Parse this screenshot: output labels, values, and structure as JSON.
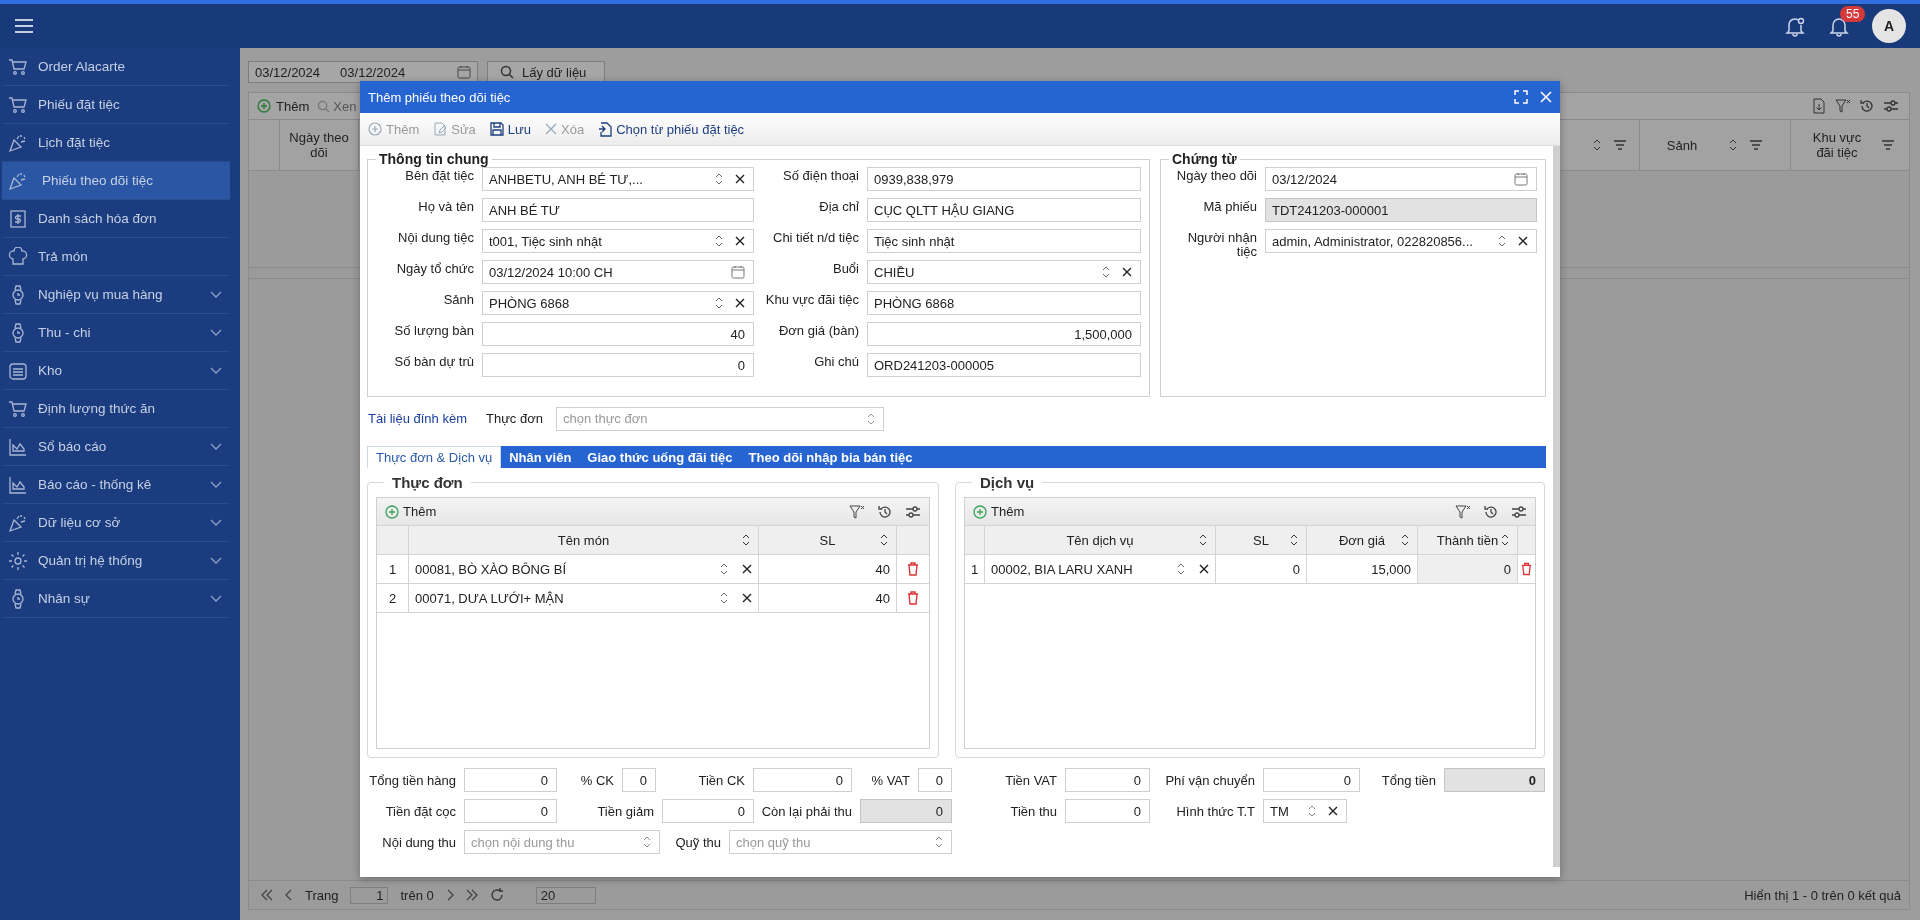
{
  "header": {
    "badge": "55",
    "avatar": "A"
  },
  "sidebar": {
    "items": [
      {
        "label": "Order Alacarte",
        "kind": "link",
        "selected": false
      },
      {
        "label": "Phiếu đặt tiệc",
        "kind": "link",
        "selected": false
      },
      {
        "label": "Lịch đặt tiệc",
        "kind": "link",
        "selected": false
      },
      {
        "label": "Phiếu theo dõi tiệc",
        "kind": "link",
        "selected": true
      },
      {
        "label": "Danh sách hóa đơn",
        "kind": "link",
        "selected": false
      },
      {
        "label": "Trả món",
        "kind": "link",
        "selected": false
      },
      {
        "label": "Nghiệp vụ mua hàng",
        "kind": "group",
        "selected": false
      },
      {
        "label": "Thu - chi",
        "kind": "group",
        "selected": false
      },
      {
        "label": "Kho",
        "kind": "group",
        "selected": false
      },
      {
        "label": "Định lượng thức ăn",
        "kind": "link",
        "selected": false
      },
      {
        "label": "Sổ báo cáo",
        "kind": "group",
        "selected": false
      },
      {
        "label": "Báo cáo - thống kê",
        "kind": "group",
        "selected": false
      },
      {
        "label": "Dữ liệu cơ sở",
        "kind": "group",
        "selected": false
      },
      {
        "label": "Quản trị hệ thống",
        "kind": "group",
        "selected": false
      },
      {
        "label": "Nhân sự",
        "kind": "group",
        "selected": false
      }
    ]
  },
  "page": {
    "date_from": "03/12/2024",
    "date_to": "03/12/2024",
    "fetch_button": "Lấy dữ liệu",
    "toolbar": [
      "Thêm",
      "Xen"
    ],
    "columns": [
      "Ngày theo dõi",
      "Sảnh",
      "Khu vực đãi tiệc"
    ],
    "pager": {
      "label": "Trang",
      "page": "1",
      "of": "trên 0",
      "size": "20",
      "summary": "Hiển thị 1 - 0 trên 0 kết quả"
    }
  },
  "modal": {
    "title": "Thêm phiếu theo dõi tiệc",
    "toolbar": [
      {
        "label": "Thêm",
        "disabled": true
      },
      {
        "label": "Sửa",
        "disabled": true
      },
      {
        "label": "Lưu",
        "disabled": false
      },
      {
        "label": "Xóa",
        "disabled": true
      },
      {
        "label": "Chọn từ phiếu đặt tiệc",
        "disabled": false
      }
    ],
    "general": {
      "title": "Thông tin chung",
      "left": [
        {
          "label": "Bên đặt tiệc",
          "value": "ANHBETU, ANH BÉ TƯ,...",
          "kind": "select",
          "readonly": false
        },
        {
          "label": "Họ và tên",
          "value": "ANH BÉ TƯ",
          "kind": "text",
          "readonly": false
        },
        {
          "label": "Nội dung tiệc",
          "value": "t001, Tiệc sinh nhật",
          "kind": "select",
          "readonly": false
        },
        {
          "label": "Ngày tổ chức",
          "value": "03/12/2024 10:00 CH",
          "kind": "date",
          "readonly": false
        },
        {
          "label": "Sảnh",
          "value": "PHÒNG 6868",
          "kind": "select",
          "readonly": false
        },
        {
          "label": "Số lượng bàn",
          "value": "40",
          "kind": "number",
          "readonly": false
        },
        {
          "label": "Số bàn dự trù",
          "value": "0",
          "kind": "number",
          "readonly": false
        }
      ],
      "right": [
        {
          "label": "Số điện thoại",
          "value": "0939,838,979",
          "kind": "text",
          "readonly": false
        },
        {
          "label": "Địa chỉ",
          "value": "CỤC QLTT HẬU GIANG",
          "kind": "text",
          "readonly": false
        },
        {
          "label": "Chi tiết n/d tiệc",
          "value": "Tiệc sinh nhật",
          "kind": "text",
          "readonly": false
        },
        {
          "label": "Buổi",
          "value": "CHIỀU",
          "kind": "select",
          "readonly": false
        },
        {
          "label": "Khu vực đãi tiệc",
          "value": "PHÒNG 6868",
          "kind": "text",
          "readonly": false
        },
        {
          "label": "Đơn giá (bàn)",
          "value": "1,500,000",
          "kind": "number",
          "readonly": false
        },
        {
          "label": "Ghi chú",
          "value": "ORD241203-000005",
          "kind": "text",
          "readonly": false
        }
      ]
    },
    "voucher": {
      "title": "Chứng từ",
      "fields": [
        {
          "label": "Ngày theo dõi",
          "value": "03/12/2024",
          "kind": "date",
          "readonly": false
        },
        {
          "label": "Mã phiếu",
          "value": "TDT241203-000001",
          "kind": "text",
          "readonly": true
        },
        {
          "label": "Người nhận tiệc",
          "value": "admin, Administrator, 022820856...",
          "kind": "select",
          "readonly": false
        }
      ]
    },
    "attachments": "Tài liệu đính kèm",
    "menu_select": {
      "label": "Thực đơn",
      "placeholder": "chọn thực đơn",
      "kind": "dropdown",
      "readonly": false
    },
    "tabs": [
      {
        "label": "Thực đơn & Dịch vụ",
        "selected": true
      },
      {
        "label": "Nhân viên",
        "selected": false
      },
      {
        "label": "Giao thức uống đãi tiệc",
        "selected": false
      },
      {
        "label": "Theo dõi nhập bia bán tiệc",
        "selected": false
      }
    ],
    "menu": {
      "title": "Thực đơn",
      "add": "Thêm",
      "columns": [
        "Tên món",
        "SL"
      ],
      "rows": [
        {
          "no": "1",
          "name": "00081, BÒ XÀO BÔNG BÍ",
          "qty": "40"
        },
        {
          "no": "2",
          "name": "00071, DƯA LƯỚI+ MẬN",
          "qty": "40"
        }
      ]
    },
    "services": {
      "title": "Dịch vụ",
      "add": "Thêm",
      "columns": [
        "Tên dịch vụ",
        "SL",
        "Đơn giá",
        "Thành tiền"
      ],
      "rows": [
        {
          "no": "1",
          "name": "00002, BIA LARU XANH",
          "qty": "0",
          "price": "15,000",
          "total": "0"
        }
      ]
    },
    "totals": [
      [
        {
          "label": "Tổng tiền hàng",
          "value": "0",
          "kind": "number",
          "readonly": false
        },
        {
          "label": "% CK",
          "value": "0",
          "kind": "number",
          "readonly": false
        },
        {
          "label": "Tiền CK",
          "value": "0",
          "kind": "number",
          "readonly": false
        },
        {
          "label": "% VAT",
          "value": "0",
          "kind": "number",
          "readonly": false
        },
        {
          "label": "Tiền VAT",
          "value": "0",
          "kind": "number",
          "readonly": false
        },
        {
          "label": "Phí vận chuyển",
          "value": "0",
          "kind": "number",
          "readonly": false
        },
        {
          "label": "Tổng tiền",
          "value": "0",
          "kind": "total",
          "readonly": true
        }
      ],
      [
        {
          "label": "Tiền đặt cọc",
          "value": "0",
          "kind": "number",
          "readonly": false
        },
        {
          "label": "Tiền giảm",
          "value": "0",
          "kind": "number",
          "readonly": false
        },
        {
          "label": "Còn lại phải thu",
          "value": "0",
          "kind": "number",
          "readonly": true
        },
        {
          "label": "Tiền thu",
          "value": "0",
          "kind": "number",
          "readonly": false
        },
        {
          "label": "Hình thức T.T",
          "value": "TM",
          "kind": "select",
          "readonly": false
        }
      ],
      [
        {
          "label": "Nội dung thu",
          "placeholder": "chọn nội dung thu",
          "kind": "dropdown",
          "readonly": false
        },
        {
          "label": "Quỹ thu",
          "placeholder": "chọn quỹ thu",
          "kind": "dropdown",
          "readonly": false
        }
      ]
    ]
  }
}
